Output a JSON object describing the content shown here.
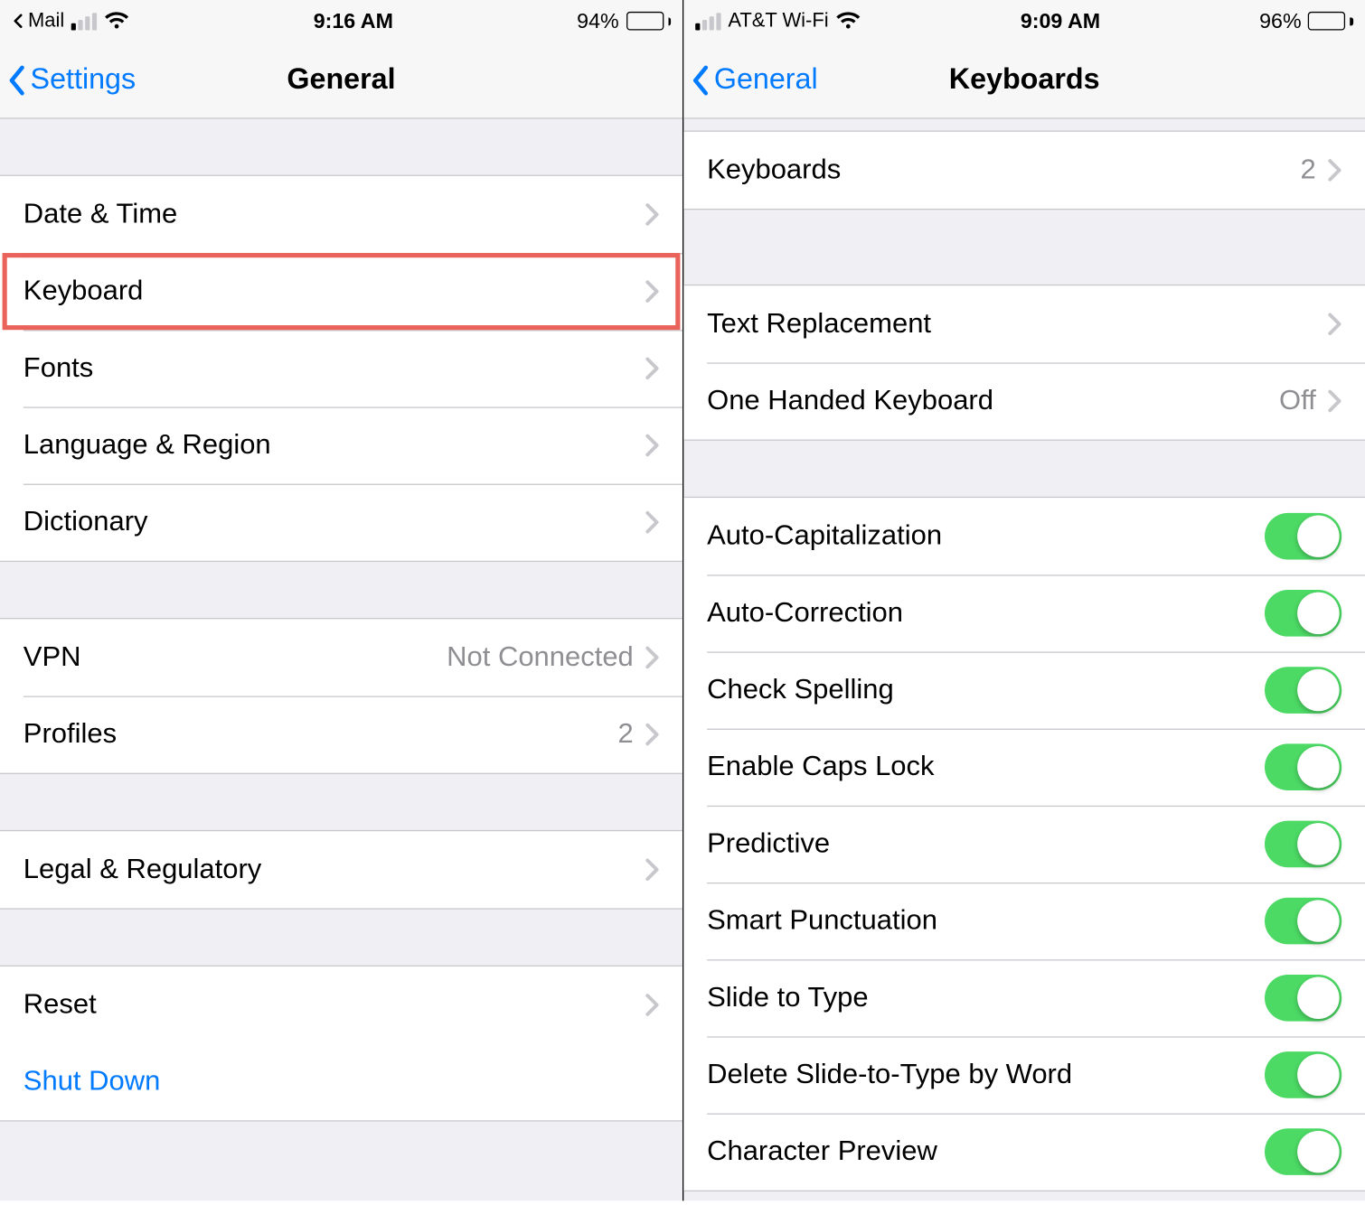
{
  "left": {
    "status": {
      "back_app_label": "Mail",
      "carrier": "",
      "time": "9:16 AM",
      "battery_pct": "94%",
      "battery_fill": 94,
      "signal_active_bars": 1
    },
    "nav": {
      "back": "Settings",
      "title": "General"
    },
    "groups": [
      {
        "rows": [
          {
            "label": "Date & Time",
            "value": "",
            "kind": "disclosure"
          },
          {
            "label": "Keyboard",
            "value": "",
            "kind": "disclosure",
            "highlighted": true
          },
          {
            "label": "Fonts",
            "value": "",
            "kind": "disclosure"
          },
          {
            "label": "Language & Region",
            "value": "",
            "kind": "disclosure"
          },
          {
            "label": "Dictionary",
            "value": "",
            "kind": "disclosure"
          }
        ]
      },
      {
        "rows": [
          {
            "label": "VPN",
            "value": "Not Connected",
            "kind": "disclosure"
          },
          {
            "label": "Profiles",
            "value": "2",
            "kind": "disclosure"
          }
        ]
      },
      {
        "rows": [
          {
            "label": "Legal & Regulatory",
            "value": "",
            "kind": "disclosure"
          }
        ]
      },
      {
        "rows": [
          {
            "label": "Reset",
            "value": "",
            "kind": "disclosure"
          },
          {
            "label": "Shut Down",
            "value": "",
            "kind": "link"
          }
        ]
      }
    ]
  },
  "right": {
    "status": {
      "carrier": "AT&T Wi-Fi",
      "time": "9:09 AM",
      "battery_pct": "96%",
      "battery_fill": 96,
      "signal_active_bars": 1
    },
    "nav": {
      "back": "General",
      "title": "Keyboards"
    },
    "groups": [
      {
        "rows": [
          {
            "label": "Keyboards",
            "value": "2",
            "kind": "disclosure"
          }
        ]
      },
      {
        "rows": [
          {
            "label": "Text Replacement",
            "value": "",
            "kind": "disclosure"
          },
          {
            "label": "One Handed Keyboard",
            "value": "Off",
            "kind": "disclosure"
          }
        ]
      },
      {
        "rows": [
          {
            "label": "Auto-Capitalization",
            "kind": "toggle",
            "on": true
          },
          {
            "label": "Auto-Correction",
            "kind": "toggle",
            "on": true
          },
          {
            "label": "Check Spelling",
            "kind": "toggle",
            "on": true
          },
          {
            "label": "Enable Caps Lock",
            "kind": "toggle",
            "on": true
          },
          {
            "label": "Predictive",
            "kind": "toggle",
            "on": true
          },
          {
            "label": "Smart Punctuation",
            "kind": "toggle",
            "on": true
          },
          {
            "label": "Slide to Type",
            "kind": "toggle",
            "on": true
          },
          {
            "label": "Delete Slide-to-Type by Word",
            "kind": "toggle",
            "on": true
          },
          {
            "label": "Character Preview",
            "kind": "toggle",
            "on": true
          }
        ]
      }
    ]
  }
}
